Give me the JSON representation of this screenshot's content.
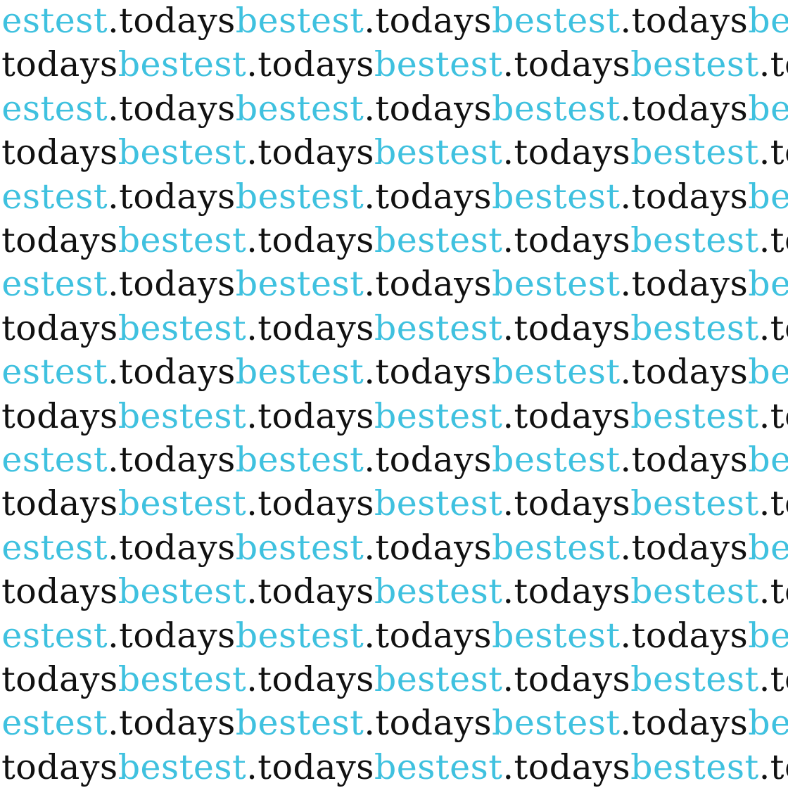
{
  "pattern": {
    "word_a": "bestest",
    "word_b": ".todays"
  },
  "colors": {
    "accent": "#3fc1df",
    "ink": "#111111",
    "background": "#ffffff"
  }
}
